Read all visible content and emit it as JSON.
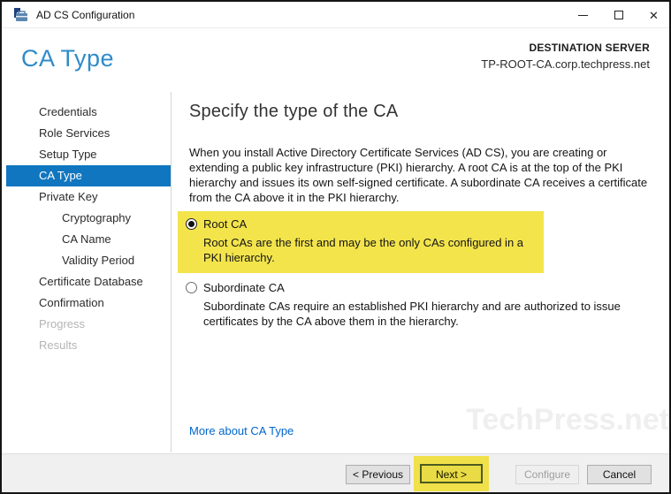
{
  "window": {
    "title": "AD CS Configuration"
  },
  "header": {
    "page_title": "CA Type",
    "destination_label": "DESTINATION SERVER",
    "destination_server": "TP-ROOT-CA.corp.techpress.net"
  },
  "sidebar": {
    "items": [
      {
        "label": "Credentials",
        "state": "normal",
        "indent": false
      },
      {
        "label": "Role Services",
        "state": "normal",
        "indent": false
      },
      {
        "label": "Setup Type",
        "state": "normal",
        "indent": false
      },
      {
        "label": "CA Type",
        "state": "selected",
        "indent": false
      },
      {
        "label": "Private Key",
        "state": "normal",
        "indent": false
      },
      {
        "label": "Cryptography",
        "state": "normal",
        "indent": true
      },
      {
        "label": "CA Name",
        "state": "normal",
        "indent": true
      },
      {
        "label": "Validity Period",
        "state": "normal",
        "indent": true
      },
      {
        "label": "Certificate Database",
        "state": "normal",
        "indent": false
      },
      {
        "label": "Confirmation",
        "state": "normal",
        "indent": false
      },
      {
        "label": "Progress",
        "state": "disabled",
        "indent": false
      },
      {
        "label": "Results",
        "state": "disabled",
        "indent": false
      }
    ]
  },
  "main": {
    "heading": "Specify the type of the CA",
    "intro": "When you install Active Directory Certificate Services (AD CS), you are creating or extending a public key infrastructure (PKI) hierarchy. A root CA is at the top of the PKI hierarchy and issues its own self-signed certificate. A subordinate CA receives a certificate from the CA above it in the PKI hierarchy.",
    "options": [
      {
        "label": "Root CA",
        "description": "Root CAs are the first and may be the only CAs configured in a PKI hierarchy.",
        "selected": true,
        "highlighted": true
      },
      {
        "label": "Subordinate CA",
        "description": "Subordinate CAs require an established PKI hierarchy and are authorized to issue certificates by the CA above them in the hierarchy.",
        "selected": false,
        "highlighted": false
      }
    ],
    "more_link": "More about CA Type"
  },
  "watermark": "TechPress.net",
  "footer": {
    "buttons": [
      {
        "label": "< Previous",
        "state": "enabled",
        "highlighted": false
      },
      {
        "label": "Next >",
        "state": "enabled",
        "highlighted": true
      },
      {
        "label": "Configure",
        "state": "disabled",
        "highlighted": false
      },
      {
        "label": "Cancel",
        "state": "enabled",
        "highlighted": false
      }
    ]
  },
  "colors": {
    "accent_blue": "#2E8BC9",
    "sidebar_selected_blue": "#1076BF",
    "link_blue": "#0066CC",
    "annotation_yellow": "#F3E44C",
    "next_border_olive": "#4c5a1e",
    "footer_gray": "#F0F0F0"
  }
}
